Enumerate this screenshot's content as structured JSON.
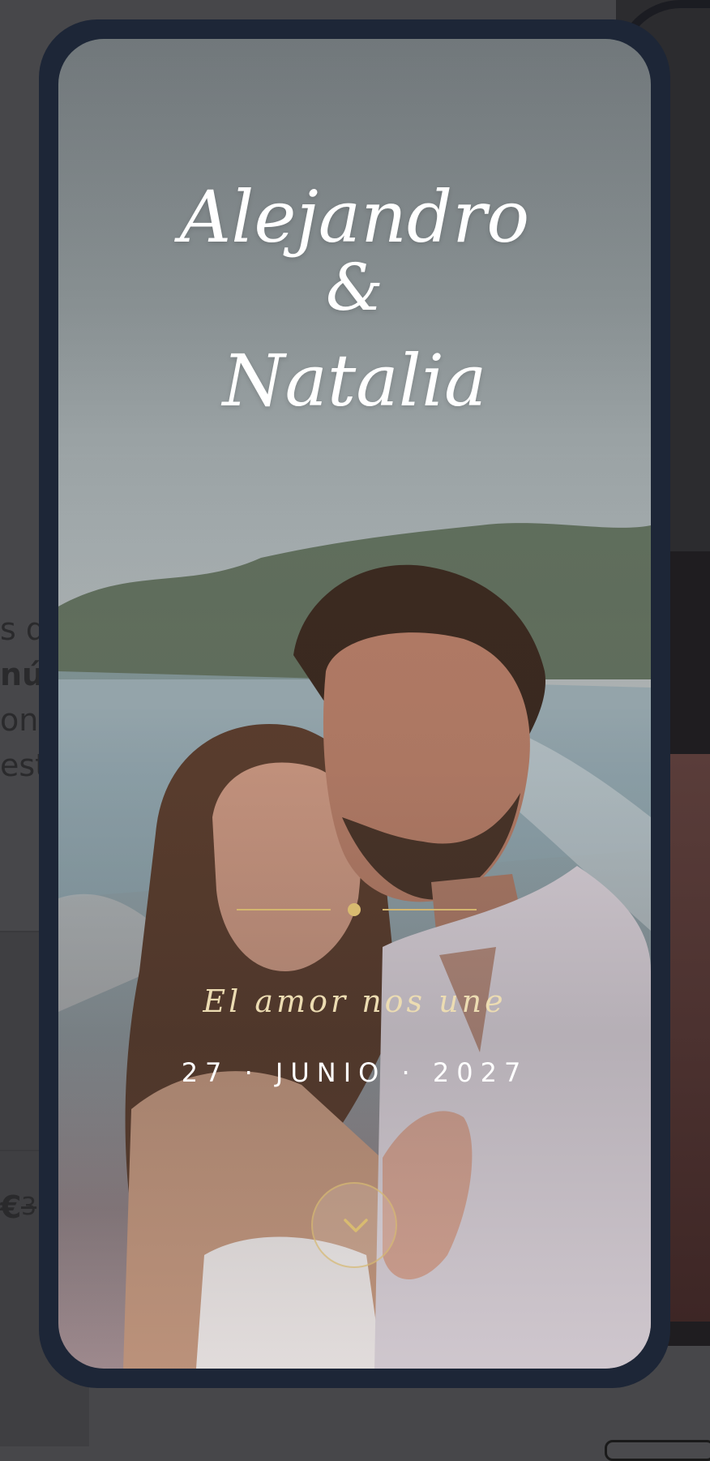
{
  "background_page": {
    "fragments": [
      "s qu",
      "nú",
      "on",
      "est"
    ],
    "price_fragment": "€",
    "old_price_fragment": "3"
  },
  "invitation": {
    "name_1": "Alejandro",
    "ampersand": "&",
    "name_2": "Natalia",
    "tagline": "El amor nos une",
    "date": "27 · JUNIO · 2027",
    "scroll_icon": "chevron-down-icon"
  },
  "colors": {
    "frame": "#1d2637",
    "gold": "#d8bb70",
    "text": "#ffffff",
    "tagline": "#ecdcb2"
  }
}
